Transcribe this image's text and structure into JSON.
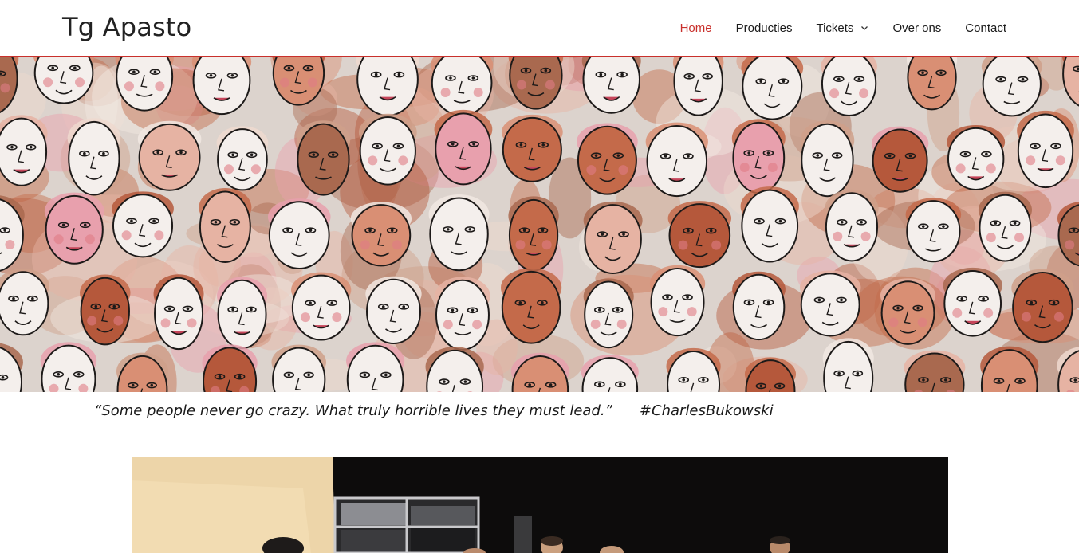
{
  "site": {
    "title": "Tg Apasto",
    "accent_color": "#c9302c"
  },
  "nav": {
    "items": [
      {
        "label": "Home",
        "active": true
      },
      {
        "label": "Producties",
        "active": false
      },
      {
        "label": "Tickets",
        "active": false,
        "icon": "chevron-down-icon"
      },
      {
        "label": "Over ons",
        "active": false
      },
      {
        "label": "Contact",
        "active": false
      }
    ]
  },
  "hero": {
    "image": "watercolor-crowd-of-faces"
  },
  "quote": {
    "text": "“Some people never go crazy. What truly horrible lives they must lead.”",
    "hashtag": "#CharlesBukowski"
  },
  "photo": {
    "image": "theatre-stage-performance"
  }
}
